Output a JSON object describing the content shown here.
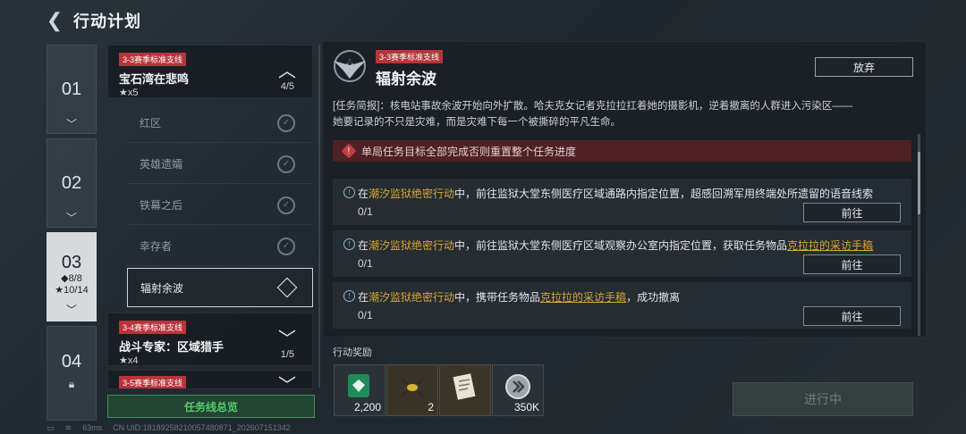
{
  "header": {
    "back_icon": "back-arrow-icon",
    "title": "行动计划"
  },
  "seasons": [
    {
      "num": "01"
    },
    {
      "num": "02"
    },
    {
      "num": "03",
      "stat1": "◆8/8",
      "stat2": "★10/14"
    },
    {
      "num": "04"
    }
  ],
  "missions": [
    {
      "tag": "3-3赛季标准支线",
      "name": "宝石湾在悲鸣",
      "stars": "★x5",
      "progress": "4/5"
    },
    {
      "tag": "3-4赛季标准支线",
      "name": "战斗专家：区域猎手",
      "stars": "★x4",
      "progress": "1/5"
    },
    {
      "tag": "3-5赛季标准支线"
    }
  ],
  "subtasks": [
    "红区",
    "英雄遗孀",
    "铁幕之后",
    "幸存者",
    "辐射余波"
  ],
  "summary_button": "任务线总览",
  "detail": {
    "tag": "3-3赛季标准支线",
    "title": "辐射余波",
    "abandon": "放弃",
    "brief_line1": "[任务简报]：核电站事故余波开始向外扩散。哈夫克女记者克拉拉扛着她的摄影机，逆着撤离的人群进入污染区——",
    "brief_line2": "她要记录的不只是灾难，而是灾难下每一个被撕碎的平凡生命。",
    "warning": "单局任务目标全部完成否则重置整个任务进度",
    "tasks": [
      {
        "pre": "在",
        "hl": "潮汐监狱绝密行动",
        "mid": "中，前往监狱大堂东侧医疗区域通路内指定位置，超感回溯军用终端处所遗留的语音线索",
        "item": "",
        "post": "",
        "progress": "0/1",
        "go": "前往"
      },
      {
        "pre": "在",
        "hl": "潮汐监狱绝密行动",
        "mid": "中，前往监狱大堂东侧医疗区域观察办公室内指定位置，获取任务物品",
        "item": "克拉拉的采访手稿",
        "post": "",
        "progress": "0/1",
        "go": "前往"
      },
      {
        "pre": "在",
        "hl": "潮汐监狱绝密行动",
        "mid": "中，携带任务物品",
        "item": "克拉拉的采访手稿",
        "post": "，成功撤离",
        "progress": "0/1",
        "go": "前往"
      }
    ],
    "rewards_label": "行动奖励",
    "rewards": [
      {
        "icon": "badge-icon",
        "count": "2,200"
      },
      {
        "icon": "insect-icon",
        "count": "2"
      },
      {
        "icon": "document-icon",
        "count": ""
      },
      {
        "icon": "coin-icon",
        "count": "350K"
      }
    ],
    "status_button": "进行中"
  },
  "statusbar": {
    "ping": "63ms",
    "uid": "CN UID:18189258210057480871_202607151342"
  }
}
